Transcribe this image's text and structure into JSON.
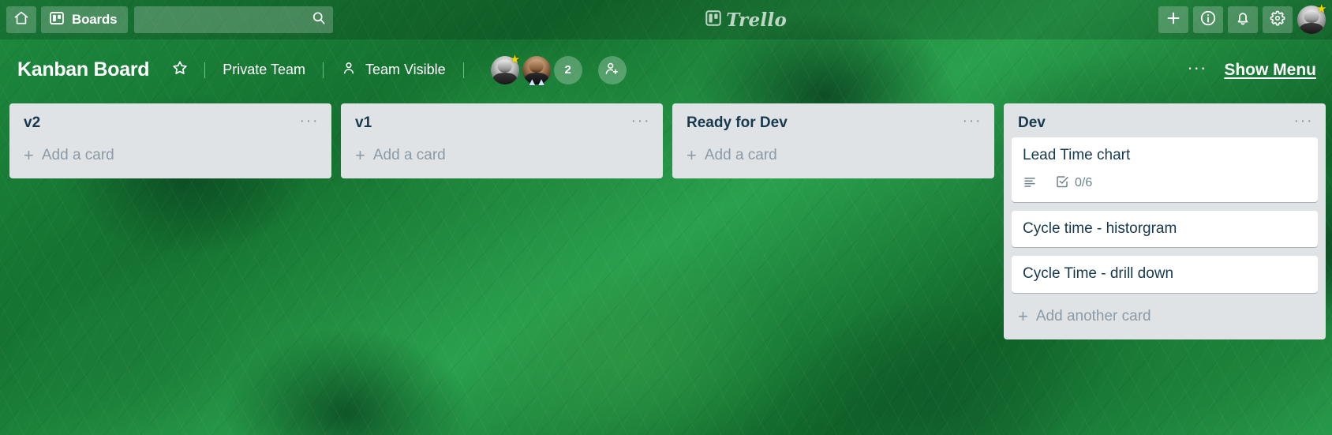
{
  "top_bar": {
    "home_icon": "home-icon",
    "boards_label": "Boards",
    "boards_icon": "board-grid-icon",
    "search": {
      "value": "",
      "placeholder": "",
      "icon": "search-icon"
    },
    "logo_text": "Trello",
    "logo_icon": "trello-board-icon",
    "actions": [
      {
        "name": "add-button",
        "icon": "plus-icon",
        "glyph": "+"
      },
      {
        "name": "info-button",
        "icon": "info-circle-icon",
        "glyph": "i"
      },
      {
        "name": "notifications-button",
        "icon": "bell-icon",
        "glyph": "bell"
      },
      {
        "name": "settings-button",
        "icon": "gear-icon",
        "glyph": "gear"
      }
    ],
    "avatar": {
      "name": "user-avatar",
      "badge": "gold-star"
    }
  },
  "board_header": {
    "title": "Kanban Board",
    "star_icon": "star-outline-icon",
    "team_label": "Private Team",
    "visibility_label": "Team Visible",
    "visibility_icon": "person-visibility-icon",
    "members": [
      {
        "name": "member-avatar-1",
        "badge": "gold-star"
      },
      {
        "name": "member-avatar-2",
        "badge": "chevrons"
      }
    ],
    "member_count": "2",
    "add_member_icon": "add-member-icon",
    "menu_dots": "···",
    "show_menu_label": "Show Menu"
  },
  "lists": [
    {
      "title": "v2",
      "menu": "···",
      "add_card_label": "Add a card",
      "cards": []
    },
    {
      "title": "v1",
      "menu": "···",
      "add_card_label": "Add a card",
      "cards": []
    },
    {
      "title": "Ready for Dev",
      "menu": "···",
      "add_card_label": "Add a card",
      "cards": []
    },
    {
      "title": "Dev",
      "menu": "···",
      "add_card_label": "Add another card",
      "cards": [
        {
          "title": "Lead Time chart",
          "badges": [
            {
              "type": "description",
              "icon": "description-icon",
              "text": ""
            },
            {
              "type": "checklist",
              "icon": "checklist-icon",
              "text": "0/6"
            }
          ]
        },
        {
          "title": "Cycle time - historgram",
          "badges": []
        },
        {
          "title": "Cycle Time - drill down",
          "badges": []
        }
      ]
    }
  ],
  "colors": {
    "list_background": "#dfe3e6",
    "card_background": "#ffffff",
    "text_dark": "#17394d",
    "text_muted": "#8c9aa5",
    "board_green": "#1f8a40",
    "star_gold": "#f2d600"
  }
}
